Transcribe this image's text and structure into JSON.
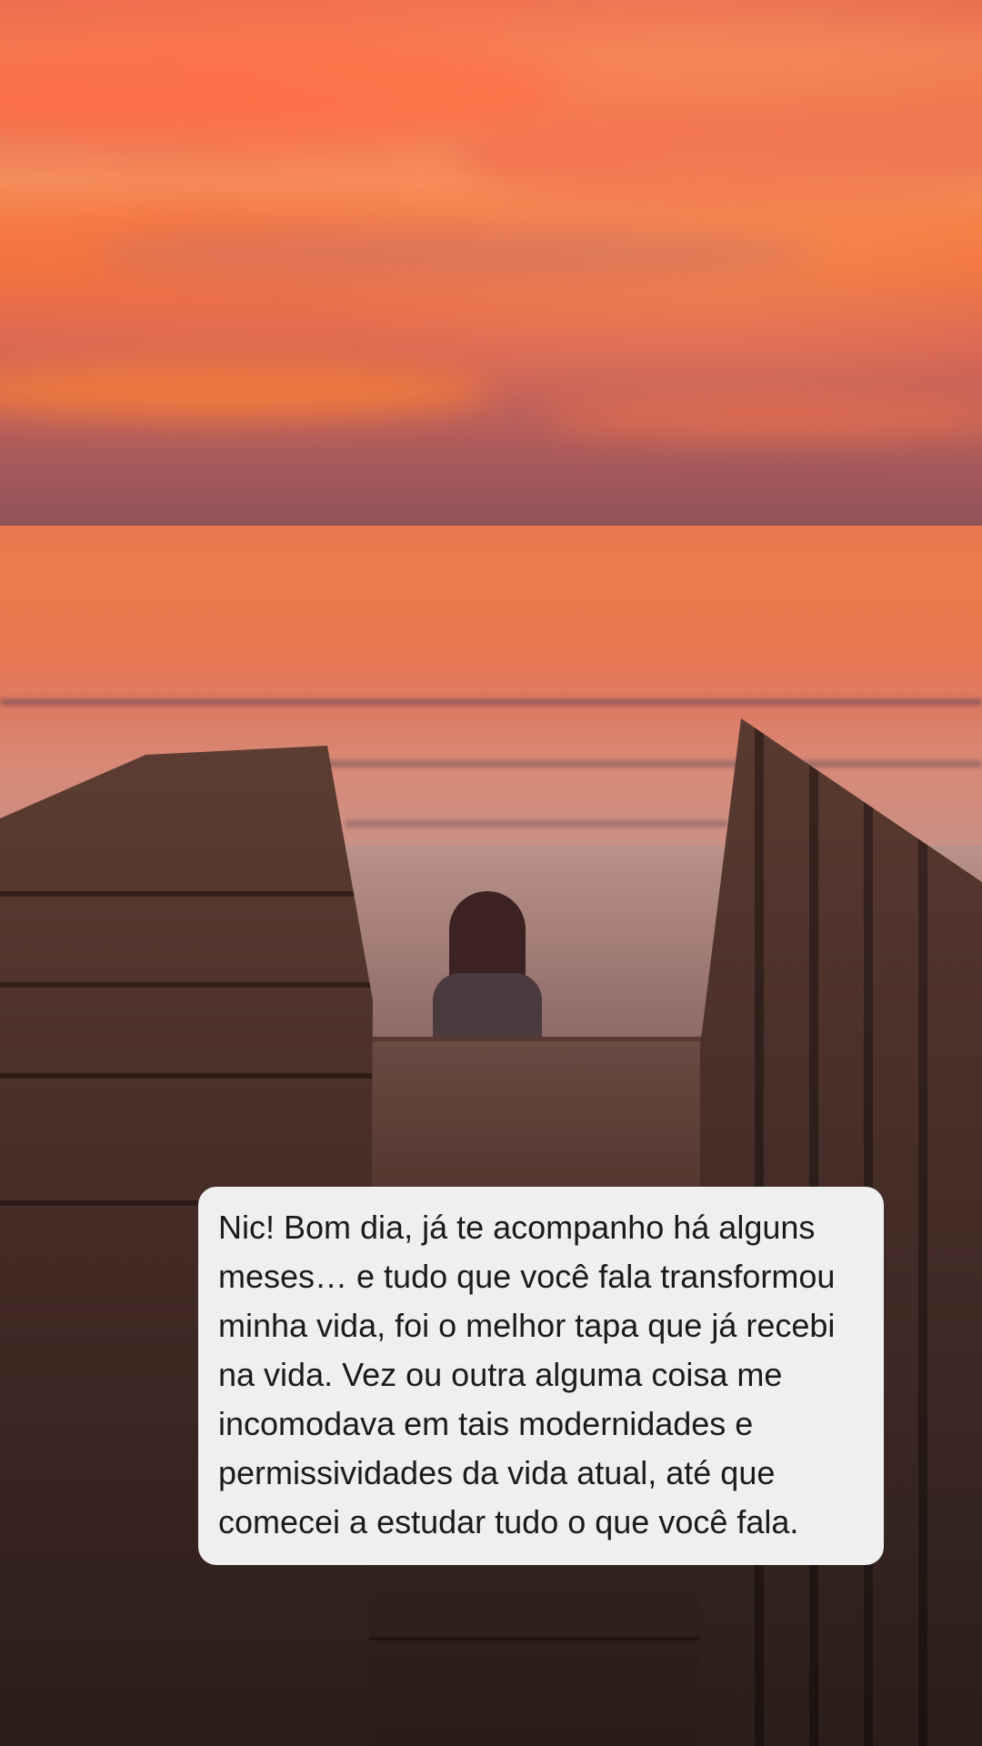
{
  "story": {
    "message": {
      "text": "Nic! Bom dia, já te acompanho há alguns meses… e tudo que você fala transformou minha vida, foi o melhor tapa que já recebi na vida. Vez ou outra alguma coisa me incomodava em tais modernidades e permissividades da vida atual, até que comecei a estudar tudo o que você fala."
    },
    "background": {
      "scene": "sunset-beach-boardwalk",
      "sky_color": "#f0773f",
      "sea_color": "#e8774f"
    },
    "bubble_color": "#efefef"
  }
}
